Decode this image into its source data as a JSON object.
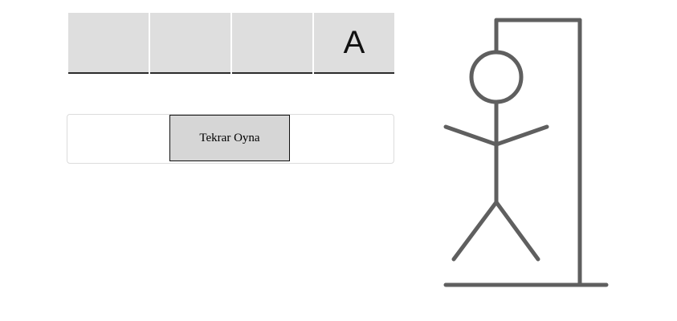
{
  "game": {
    "word_slots": [
      "",
      "",
      "",
      "A"
    ],
    "replay_label": "Tekrar Oyna",
    "drawing_color": "#5f5f5f",
    "slot_background": "#dedede",
    "hangman_parts_shown": [
      "base",
      "pole",
      "beam",
      "rope",
      "head",
      "body",
      "left-arm",
      "right-arm",
      "left-leg",
      "right-leg"
    ]
  }
}
